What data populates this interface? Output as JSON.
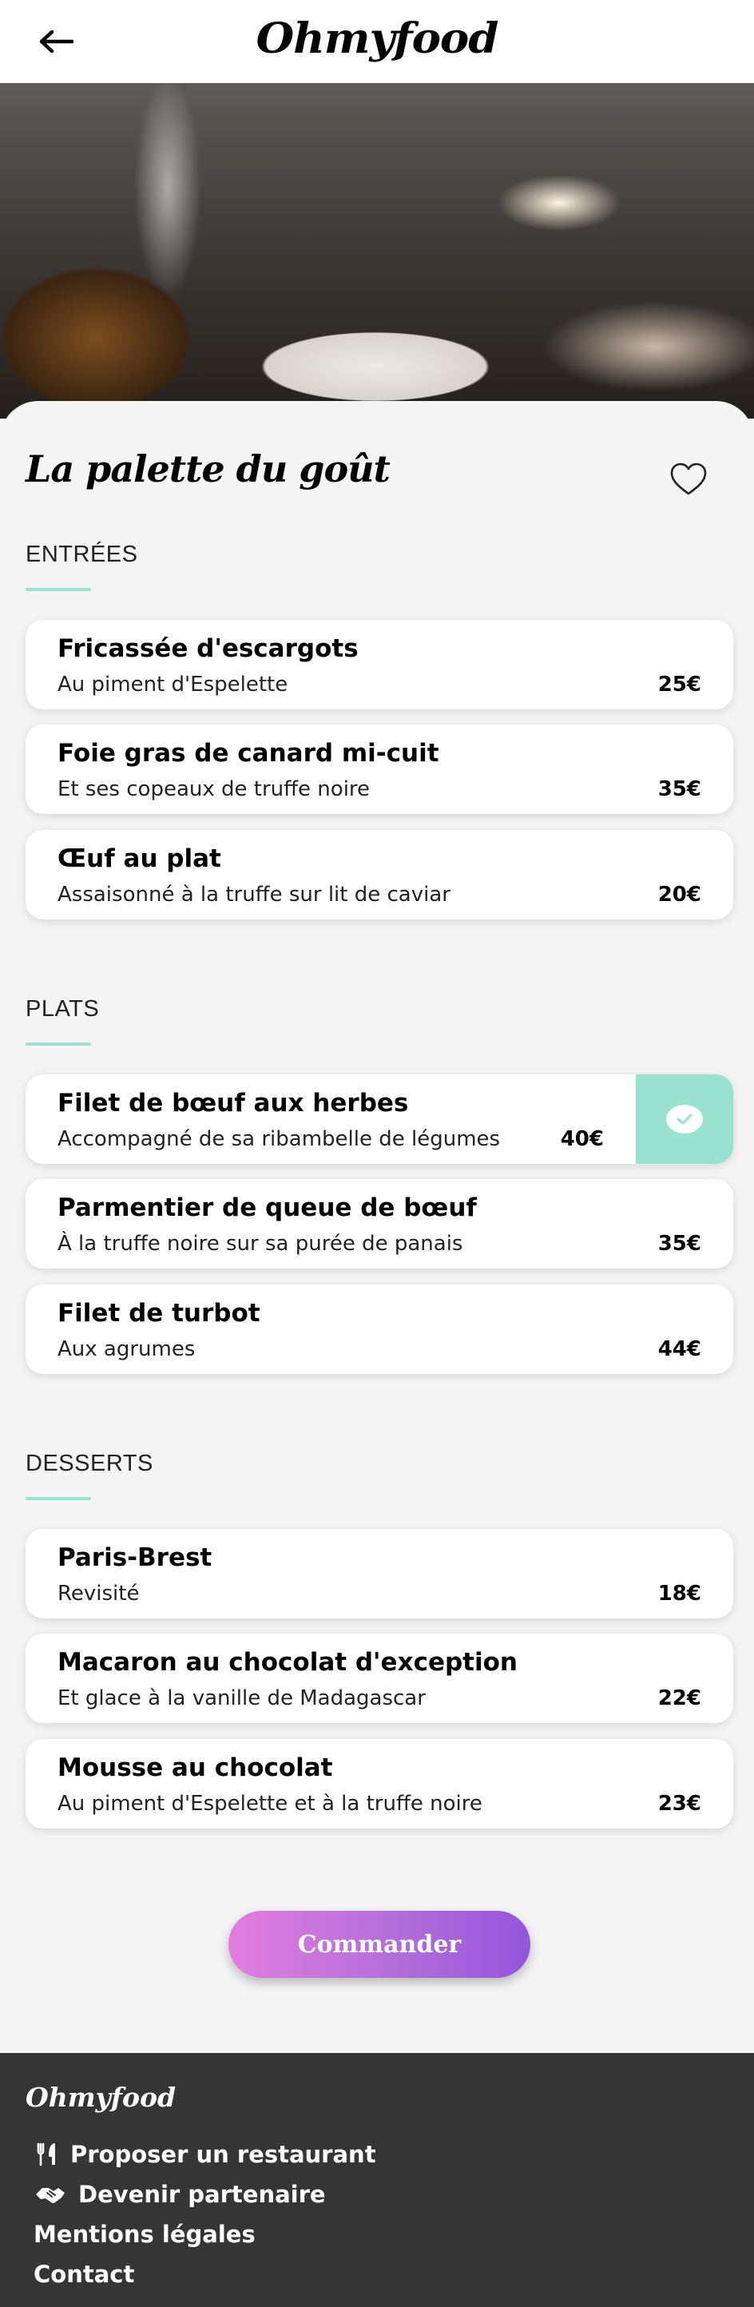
{
  "header": {
    "logo": "Ohmyfood",
    "back_icon": "arrow-left-icon"
  },
  "restaurant": {
    "name": "La palette du goût",
    "favorite_icon": "heart-outline-icon"
  },
  "sections": [
    {
      "title": "ENTRÉES",
      "items": [
        {
          "name": "Fricassée d'escargots",
          "description": "Au piment d'Espelette",
          "price": "25€"
        },
        {
          "name": "Foie gras de canard mi-cuit",
          "description": "Et ses copeaux de truffe noire",
          "price": "35€"
        },
        {
          "name": "Œuf au plat",
          "description": "Assaisonné à la truffe sur lit de caviar",
          "price": "20€"
        }
      ]
    },
    {
      "title": "PLATS",
      "items": [
        {
          "name": "Filet de bœuf aux herbes",
          "description": "Accompagné de sa ribambelle de légumes",
          "price": "40€",
          "selected": true
        },
        {
          "name": "Parmentier de queue de bœuf",
          "description": "À la truffe noire sur sa purée de panais",
          "price": "35€"
        },
        {
          "name": "Filet de turbot",
          "description": "Aux agrumes",
          "price": "44€"
        }
      ]
    },
    {
      "title": "DESSERTS",
      "items": [
        {
          "name": "Paris-Brest",
          "description": "Revisité",
          "price": "18€"
        },
        {
          "name": "Macaron au chocolat d'exception",
          "description": "Et glace à la vanille de Madagascar",
          "price": "22€"
        },
        {
          "name": "Mousse au chocolat",
          "description": "Au piment d'Espelette et à la truffe noire",
          "price": "23€"
        }
      ]
    }
  ],
  "order_button": {
    "label": "Commander"
  },
  "footer": {
    "logo": "Ohmyfood",
    "links": [
      {
        "label": "Proposer un restaurant",
        "icon": "utensils-icon"
      },
      {
        "label": "Devenir partenaire",
        "icon": "handshake-icon"
      },
      {
        "label": "Mentions légales"
      },
      {
        "label": "Contact"
      }
    ]
  },
  "colors": {
    "accent": "#99e2d0",
    "button_start": "#e27de0",
    "button_end": "#9356dc",
    "footer_bg": "#353535"
  }
}
